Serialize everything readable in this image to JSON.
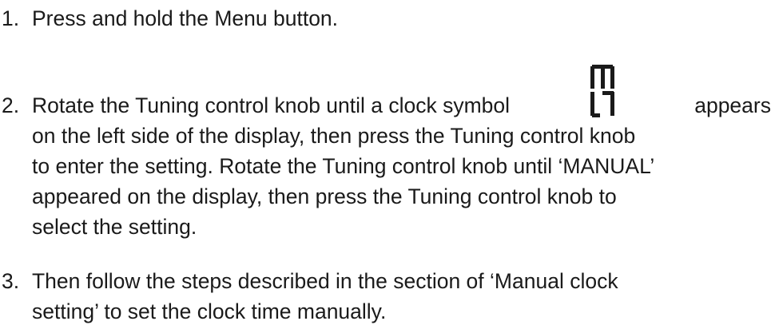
{
  "steps": [
    {
      "number": "1.",
      "lines": [
        "Press and hold the Menu button."
      ]
    },
    {
      "number": "2.",
      "line1_before_symbol": "Rotate the Tuning control knob until a clock symbol",
      "line1_after_symbol": "appears",
      "symbol_icon": "seven-segment-clock-icon",
      "lines": [
        "on the left side of the display, then press the Tuning control knob",
        "to enter the setting. Rotate the Tuning control knob until ‘MANUAL’",
        "appeared on the display, then press the Tuning control knob to",
        "select the setting."
      ]
    },
    {
      "number": "3.",
      "lines": [
        "Then follow the steps described in the section of ‘Manual clock",
        "setting’ to set the clock time manually."
      ]
    }
  ]
}
